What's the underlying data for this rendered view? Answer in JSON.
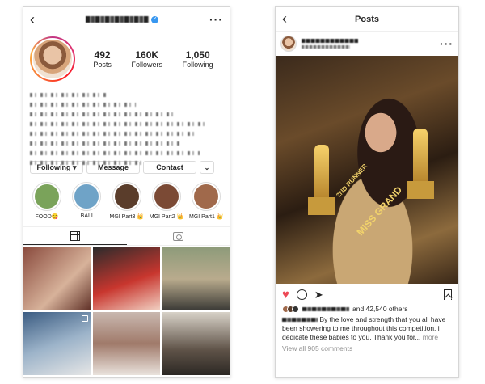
{
  "profile": {
    "stats": [
      {
        "num": "492",
        "label": "Posts"
      },
      {
        "num": "160K",
        "label": "Followers"
      },
      {
        "num": "1,050",
        "label": "Following"
      }
    ],
    "buttons": {
      "following": "Following ▾",
      "message": "Message",
      "contact": "Contact",
      "dropdown": "⌄"
    },
    "highlights": [
      {
        "label": "FOOD😋",
        "color": "#7aa35a"
      },
      {
        "label": "BALI",
        "color": "#6fa3c7"
      },
      {
        "label": "MGI Part3 👑",
        "color": "#5a3d2b"
      },
      {
        "label": "MGI Part2 👑",
        "color": "#7b4a35"
      },
      {
        "label": "MGI Part1 👑",
        "color": "#a0694b"
      }
    ],
    "grid_colors": [
      "#8a4b3e",
      "#c8362e",
      "#b9ab8d",
      "#3b5c82",
      "#a07a6a",
      "#5f5348"
    ]
  },
  "post": {
    "title": "Posts",
    "image": {
      "sash_text": "MISS GRAND",
      "sash_sub": "2ND RUNNER"
    },
    "likes_suffix": "and 42,540 others",
    "caption": "By the love and strength that you all have been showering to me throughout this competition, i dedicate these babies to you. Thank you for...",
    "caption_more": "more",
    "view_comments": "View all 905 comments"
  },
  "colors": {
    "accent": "#3897f0",
    "heart": "#ed4956"
  }
}
